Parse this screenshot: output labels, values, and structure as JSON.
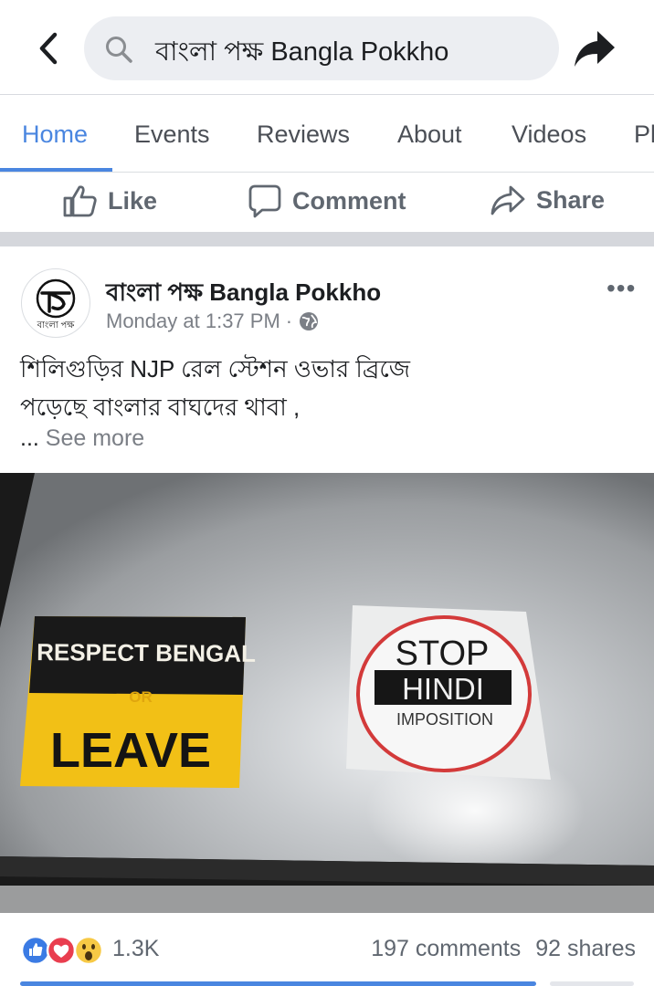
{
  "search": {
    "query": "বাংলা পক্ষ Bangla Pokkho"
  },
  "tabs": [
    "Home",
    "Events",
    "Reviews",
    "About",
    "Videos",
    "Pl"
  ],
  "actions": {
    "like": "Like",
    "comment": "Comment",
    "share": "Share"
  },
  "post": {
    "page_name": "বাংলা পক্ষ Bangla Pokkho",
    "avatar_label": "বাংলা পক্ষ",
    "timestamp": "Monday at 1:37 PM",
    "text_line1": "শিলিগুড়ির NJP রেল স্টেশন ওভার ব্রিজে",
    "text_line2": "পড়েছে বাংলার বাঘদের থাবা ,",
    "ellipsis": "...",
    "see_more": "See more"
  },
  "image": {
    "sticker1_line1": "RESPECT BENGAL",
    "sticker1_or": "OR",
    "sticker1_line2": "LEAVE",
    "sticker2_stop": "STOP",
    "sticker2_hindi": "HINDI",
    "sticker2_imposition": "IMPOSITION"
  },
  "stats": {
    "reactions": "1.3K",
    "comments": "197 comments",
    "shares": "92 shares"
  },
  "colors": {
    "accent": "#4a86e0",
    "sticker_yellow": "#f2c016",
    "stop_red": "#d33a3a"
  }
}
